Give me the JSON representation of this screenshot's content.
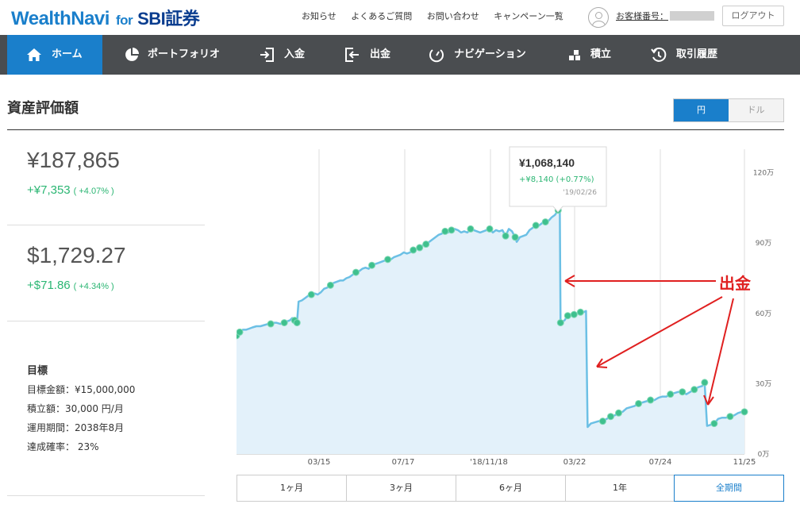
{
  "header": {
    "logo_main": "WealthNavi",
    "logo_for": "for",
    "logo_partner": "SBI証券",
    "links": [
      "お知らせ",
      "よくあるご質問",
      "お問い合わせ",
      "キャンペーン一覧"
    ],
    "customer_no_label": "お客様番号：",
    "logout_label": "ログアウト"
  },
  "nav": {
    "items": [
      {
        "label": "ホーム",
        "icon": "home-icon"
      },
      {
        "label": "ポートフォリオ",
        "icon": "pie-chart-icon"
      },
      {
        "label": "入金",
        "icon": "deposit-icon"
      },
      {
        "label": "出金",
        "icon": "withdraw-icon"
      },
      {
        "label": "ナビゲーション",
        "icon": "gauge-icon"
      },
      {
        "label": "積立",
        "icon": "blocks-icon"
      },
      {
        "label": "取引履歴",
        "icon": "history-icon"
      }
    ],
    "active": "ホーム"
  },
  "section": {
    "title": "資産評価額",
    "currency_options": [
      "円",
      "ドル"
    ],
    "currency_selected": "円"
  },
  "summary": {
    "jpy_amount": "¥187,865",
    "jpy_gain": "+¥7,353",
    "jpy_gain_pct": "( +4.07% )",
    "usd_amount": "$1,729.27",
    "usd_gain": "+$71.86",
    "usd_gain_pct": "( +4.34% )"
  },
  "goal": {
    "heading": "目標",
    "target_amount": "目標金額：¥15,000,000",
    "monthly": "積立額：30,000 円/月",
    "period": "運用期間：2038年8月",
    "probability": "達成確率： 23%"
  },
  "colors": {
    "brand": "#1a7fcb",
    "nav_bg": "#4a4d50",
    "gain": "#2bb673",
    "line": "#6cc0e5",
    "area": "#e3f1fa",
    "annotation": "#e02020"
  },
  "chart_data": {
    "type": "area",
    "x_tick_labels": [
      "03/15",
      "07/17",
      "'18/11/18",
      "03/22",
      "07/24",
      "11/25"
    ],
    "y_tick_labels": [
      "0万",
      "30万",
      "60万",
      "90万",
      "120万"
    ],
    "ylim": [
      0,
      1300000
    ],
    "y_unit": "円",
    "grid": true,
    "series": [
      {
        "points": [
          [
            0,
            505000
          ],
          [
            4,
            520000
          ],
          [
            8,
            530000
          ],
          [
            12,
            530000
          ],
          [
            16,
            535000
          ],
          [
            20,
            540000
          ],
          [
            25,
            545000
          ],
          [
            30,
            545000
          ],
          [
            35,
            550000
          ],
          [
            40,
            555000
          ],
          [
            43,
            555000
          ],
          [
            46,
            560000
          ],
          [
            50,
            560000
          ],
          [
            55,
            555000
          ],
          [
            60,
            560000
          ],
          [
            63,
            565000
          ],
          [
            67,
            570000
          ],
          [
            70,
            580000
          ],
          [
            73,
            570000
          ],
          [
            76,
            560000
          ],
          [
            78,
            650000
          ],
          [
            82,
            655000
          ],
          [
            86,
            665000
          ],
          [
            90,
            675000
          ],
          [
            94,
            680000
          ],
          [
            98,
            685000
          ],
          [
            102,
            680000
          ],
          [
            106,
            690000
          ],
          [
            110,
            705000
          ],
          [
            114,
            710000
          ],
          [
            118,
            720000
          ],
          [
            122,
            730000
          ],
          [
            126,
            735000
          ],
          [
            130,
            740000
          ],
          [
            134,
            740000
          ],
          [
            138,
            750000
          ],
          [
            142,
            755000
          ],
          [
            146,
            765000
          ],
          [
            150,
            775000
          ],
          [
            154,
            780000
          ],
          [
            158,
            790000
          ],
          [
            162,
            795000
          ],
          [
            166,
            790000
          ],
          [
            170,
            805000
          ],
          [
            174,
            810000
          ],
          [
            178,
            815000
          ],
          [
            182,
            820000
          ],
          [
            186,
            825000
          ],
          [
            190,
            830000
          ],
          [
            194,
            830000
          ],
          [
            198,
            840000
          ],
          [
            202,
            845000
          ],
          [
            206,
            850000
          ],
          [
            210,
            860000
          ],
          [
            214,
            855000
          ],
          [
            218,
            860000
          ],
          [
            222,
            870000
          ],
          [
            226,
            875000
          ],
          [
            230,
            880000
          ],
          [
            234,
            890000
          ],
          [
            238,
            895000
          ],
          [
            242,
            905000
          ],
          [
            246,
            915000
          ],
          [
            250,
            925000
          ],
          [
            254,
            935000
          ],
          [
            258,
            940000
          ],
          [
            262,
            950000
          ],
          [
            266,
            945000
          ],
          [
            270,
            955000
          ],
          [
            274,
            960000
          ],
          [
            278,
            955000
          ],
          [
            282,
            945000
          ],
          [
            286,
            950000
          ],
          [
            290,
            945000
          ],
          [
            294,
            960000
          ],
          [
            298,
            955000
          ],
          [
            302,
            950000
          ],
          [
            306,
            945000
          ],
          [
            310,
            950000
          ],
          [
            314,
            955000
          ],
          [
            318,
            960000
          ],
          [
            322,
            945000
          ],
          [
            326,
            955000
          ],
          [
            330,
            950000
          ],
          [
            334,
            955000
          ],
          [
            338,
            930000
          ],
          [
            342,
            960000
          ],
          [
            346,
            950000
          ],
          [
            350,
            925000
          ],
          [
            352,
            905000
          ],
          [
            356,
            925000
          ],
          [
            360,
            930000
          ],
          [
            364,
            935000
          ],
          [
            368,
            955000
          ],
          [
            372,
            965000
          ],
          [
            376,
            975000
          ],
          [
            380,
            975000
          ],
          [
            384,
            985000
          ],
          [
            388,
            990000
          ],
          [
            392,
            995000
          ],
          [
            396,
            1010000
          ],
          [
            400,
            1020000
          ],
          [
            404,
            1040000
          ],
          [
            406,
            1068140
          ],
          [
            407,
            560000
          ],
          [
            412,
            570000
          ],
          [
            416,
            590000
          ],
          [
            420,
            595000
          ],
          [
            424,
            595000
          ],
          [
            428,
            600000
          ],
          [
            432,
            605000
          ],
          [
            436,
            605000
          ],
          [
            439,
            610000
          ],
          [
            441,
            115000
          ],
          [
            445,
            130000
          ],
          [
            450,
            135000
          ],
          [
            455,
            140000
          ],
          [
            460,
            140000
          ],
          [
            465,
            150000
          ],
          [
            470,
            160000
          ],
          [
            475,
            165000
          ],
          [
            480,
            175000
          ],
          [
            485,
            180000
          ],
          [
            490,
            195000
          ],
          [
            495,
            200000
          ],
          [
            500,
            205000
          ],
          [
            505,
            215000
          ],
          [
            510,
            220000
          ],
          [
            515,
            225000
          ],
          [
            520,
            230000
          ],
          [
            525,
            230000
          ],
          [
            530,
            240000
          ],
          [
            535,
            245000
          ],
          [
            540,
            245000
          ],
          [
            545,
            255000
          ],
          [
            550,
            260000
          ],
          [
            555,
            265000
          ],
          [
            560,
            265000
          ],
          [
            565,
            255000
          ],
          [
            570,
            265000
          ],
          [
            575,
            275000
          ],
          [
            580,
            285000
          ],
          [
            585,
            290000
          ],
          [
            588,
            305000
          ],
          [
            591,
            120000
          ],
          [
            596,
            125000
          ],
          [
            600,
            130000
          ],
          [
            605,
            150000
          ],
          [
            610,
            155000
          ],
          [
            615,
            155000
          ],
          [
            620,
            160000
          ],
          [
            625,
            165000
          ],
          [
            630,
            175000
          ],
          [
            635,
            180000
          ],
          [
            638,
            180000
          ]
        ]
      }
    ],
    "tooltip": {
      "value": "¥1,068,140",
      "change": "+¥8,140 (+0.77%)",
      "date": "'19/02/26"
    },
    "annotation": "出金"
  },
  "periods": {
    "options": [
      "1ヶ月",
      "3ヶ月",
      "6ヶ月",
      "1年",
      "全期間"
    ],
    "selected": "全期間"
  }
}
